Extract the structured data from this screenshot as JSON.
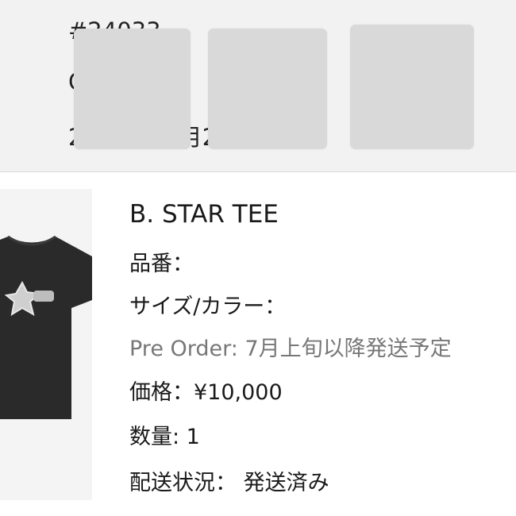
{
  "order_header": {
    "line1": "#24033",
    "line2": "C",
    "line3": "2023年05月23日(火)  分"
  },
  "product": {
    "title": "B. STAR TEE",
    "sku_label": "品番：",
    "size_color_label": "サイズ/カラー：",
    "preorder_note": "Pre Order: 7月上旬以降発送予定",
    "price": "価格：¥10,000",
    "quantity": "数量: 1",
    "shipping_status": "配送状況： 発送済み"
  },
  "colors": {
    "header_bg": "#f2f2f2",
    "mask": "#d9d9d9",
    "muted_text": "#777777",
    "tee": "#2a2a2a"
  }
}
